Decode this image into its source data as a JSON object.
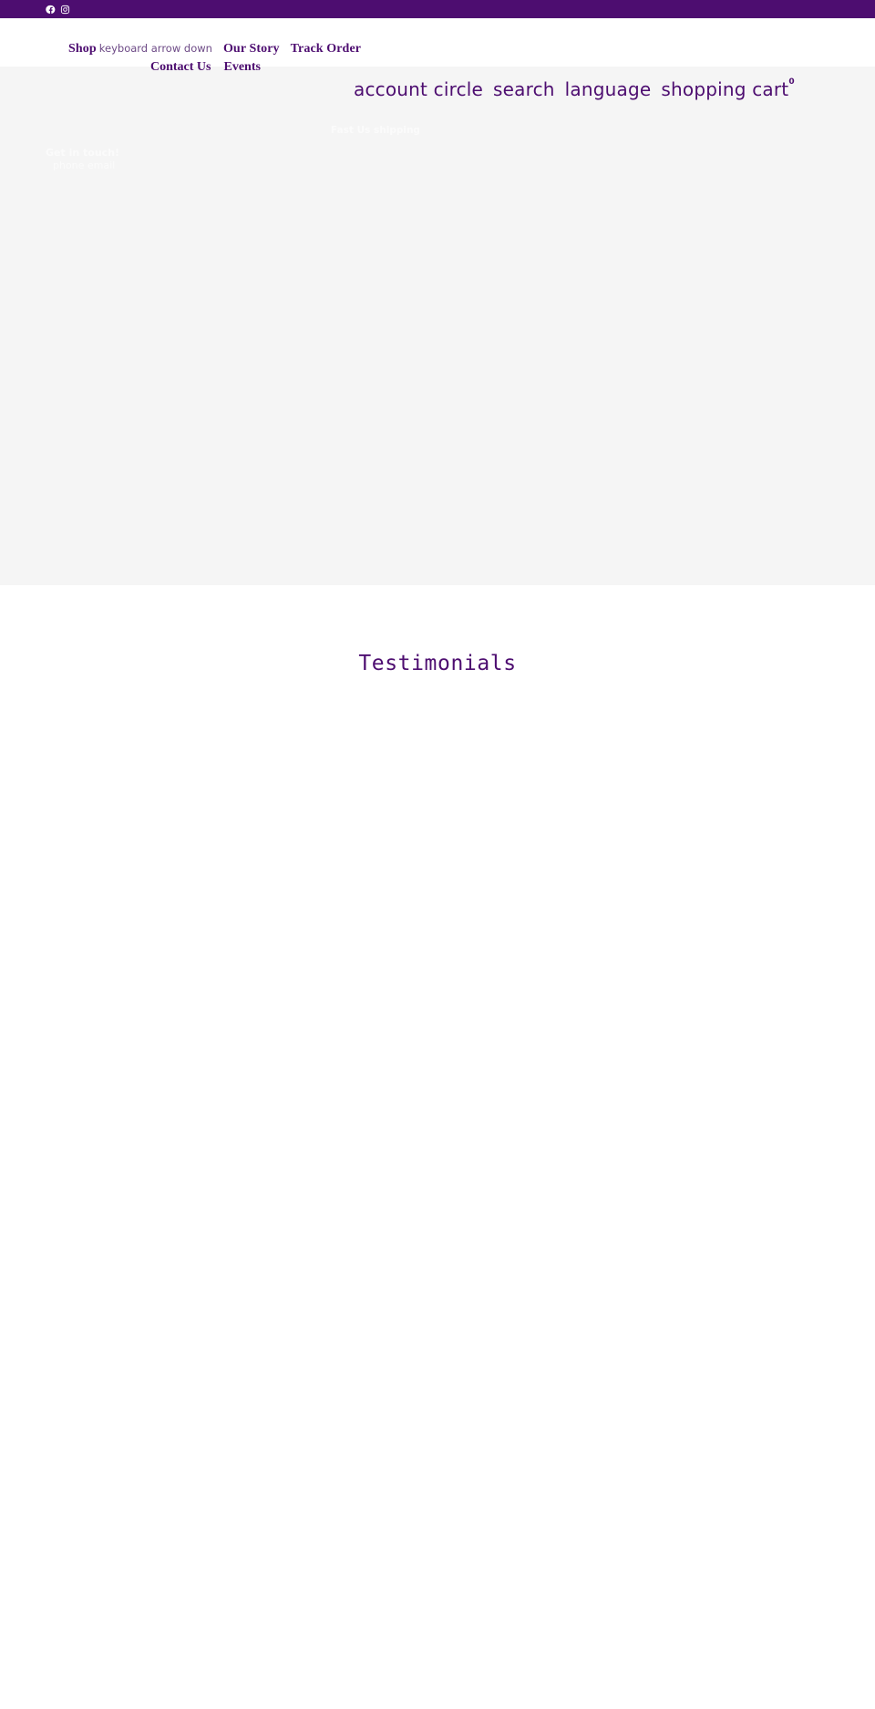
{
  "site": {
    "theme_color": "#4d0d70",
    "hero_background": "#f5f5f5",
    "page_background": "#ffffff"
  },
  "social_bar": {
    "links": [
      {
        "name": "facebook",
        "icon": "facebook-icon",
        "label": "Facebook"
      },
      {
        "name": "instagram",
        "icon": "instagram-icon",
        "label": "Instagram"
      }
    ]
  },
  "nav": {
    "primary": [
      {
        "label": "Shop",
        "icon_label": "keyboard arrow down",
        "icon": "chevron-down-icon"
      },
      {
        "label": "Our Story"
      },
      {
        "label": "Track Order"
      }
    ],
    "secondary": [
      {
        "label": "Contact Us"
      },
      {
        "label": "Events"
      }
    ]
  },
  "utility": {
    "items": [
      {
        "label": "account circle",
        "icon": "account-circle-icon"
      },
      {
        "label": "search",
        "icon": "search-icon"
      },
      {
        "label": "language",
        "icon": "language-icon"
      },
      {
        "label": "shopping cart",
        "icon": "shopping-cart-icon"
      }
    ],
    "cart_count": "0"
  },
  "hero": {
    "contact_prompt": "Get in touch!",
    "contact_detail": "phone  email",
    "shipping_note": "Fast Us shipping"
  },
  "testimonials": {
    "title": "Testimonials"
  }
}
